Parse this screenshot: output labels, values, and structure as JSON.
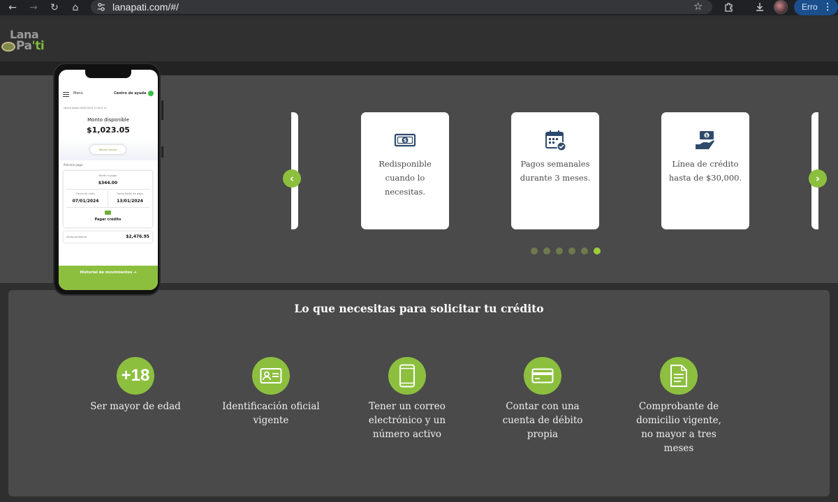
{
  "browser": {
    "url": "lanapati.com/#/",
    "profile_label": "Erro"
  },
  "logo": {
    "line1": "Lana",
    "line2_a": "Pa",
    "line2_b": "'ti"
  },
  "carousel": {
    "cards": [
      {
        "icon": "money-icon",
        "text": "Redisponible cuando lo necesitas."
      },
      {
        "icon": "calendar-check-icon",
        "text": "Pagos semanales durante 3 meses."
      },
      {
        "icon": "hand-money-icon",
        "text": "Línea de crédito hasta de $30,000."
      }
    ],
    "dots_total": 6,
    "active_dot": 6,
    "prev_icon": "chevron-left-icon",
    "next_icon": "chevron-right-icon"
  },
  "phone": {
    "menu_label": "Menú",
    "help_label": "Centro de ayuda",
    "small_text": "Última sesión 08/01/2024 11:59 a. m.",
    "monto_label": "Monto disponible",
    "monto_value": "$1,023.05",
    "retirar_label": "Retirar dinero",
    "proximo_label": "Próximo pago",
    "monto_pagar_label": "Monto a pagar",
    "monto_pagar_value": "$344.00",
    "fecha_corte_label": "Fecha de corte",
    "fecha_corte_value": "07/01/2024",
    "fecha_limite_label": "Fecha límite de pago",
    "fecha_limite_value": "13/01/2024",
    "pagar_label": "Pagar crédito",
    "saldo_label": "Saldo pendiente",
    "saldo_value": "$2,476.95",
    "footer_label": "Historial de movimientos"
  },
  "requirements": {
    "title": "Lo que necesitas para solicitar tu crédito",
    "items": [
      {
        "icon": "plus-18-icon",
        "badge": "+18",
        "text": "Ser mayor de edad"
      },
      {
        "icon": "id-card-icon",
        "text": "Identificación oficial vigente"
      },
      {
        "icon": "smartphone-icon",
        "text": "Tener un correo electrónico y un número activo"
      },
      {
        "icon": "credit-card-icon",
        "text": "Contar con una cuenta de débito propia"
      },
      {
        "icon": "document-icon",
        "text": "Comprobante de domicilio vigente, no mayor a tres meses"
      }
    ]
  },
  "colors": {
    "accent_green": "#8dbf3f",
    "icon_navy": "#2d4a6b",
    "panel_gray": "#4a4a4a"
  }
}
